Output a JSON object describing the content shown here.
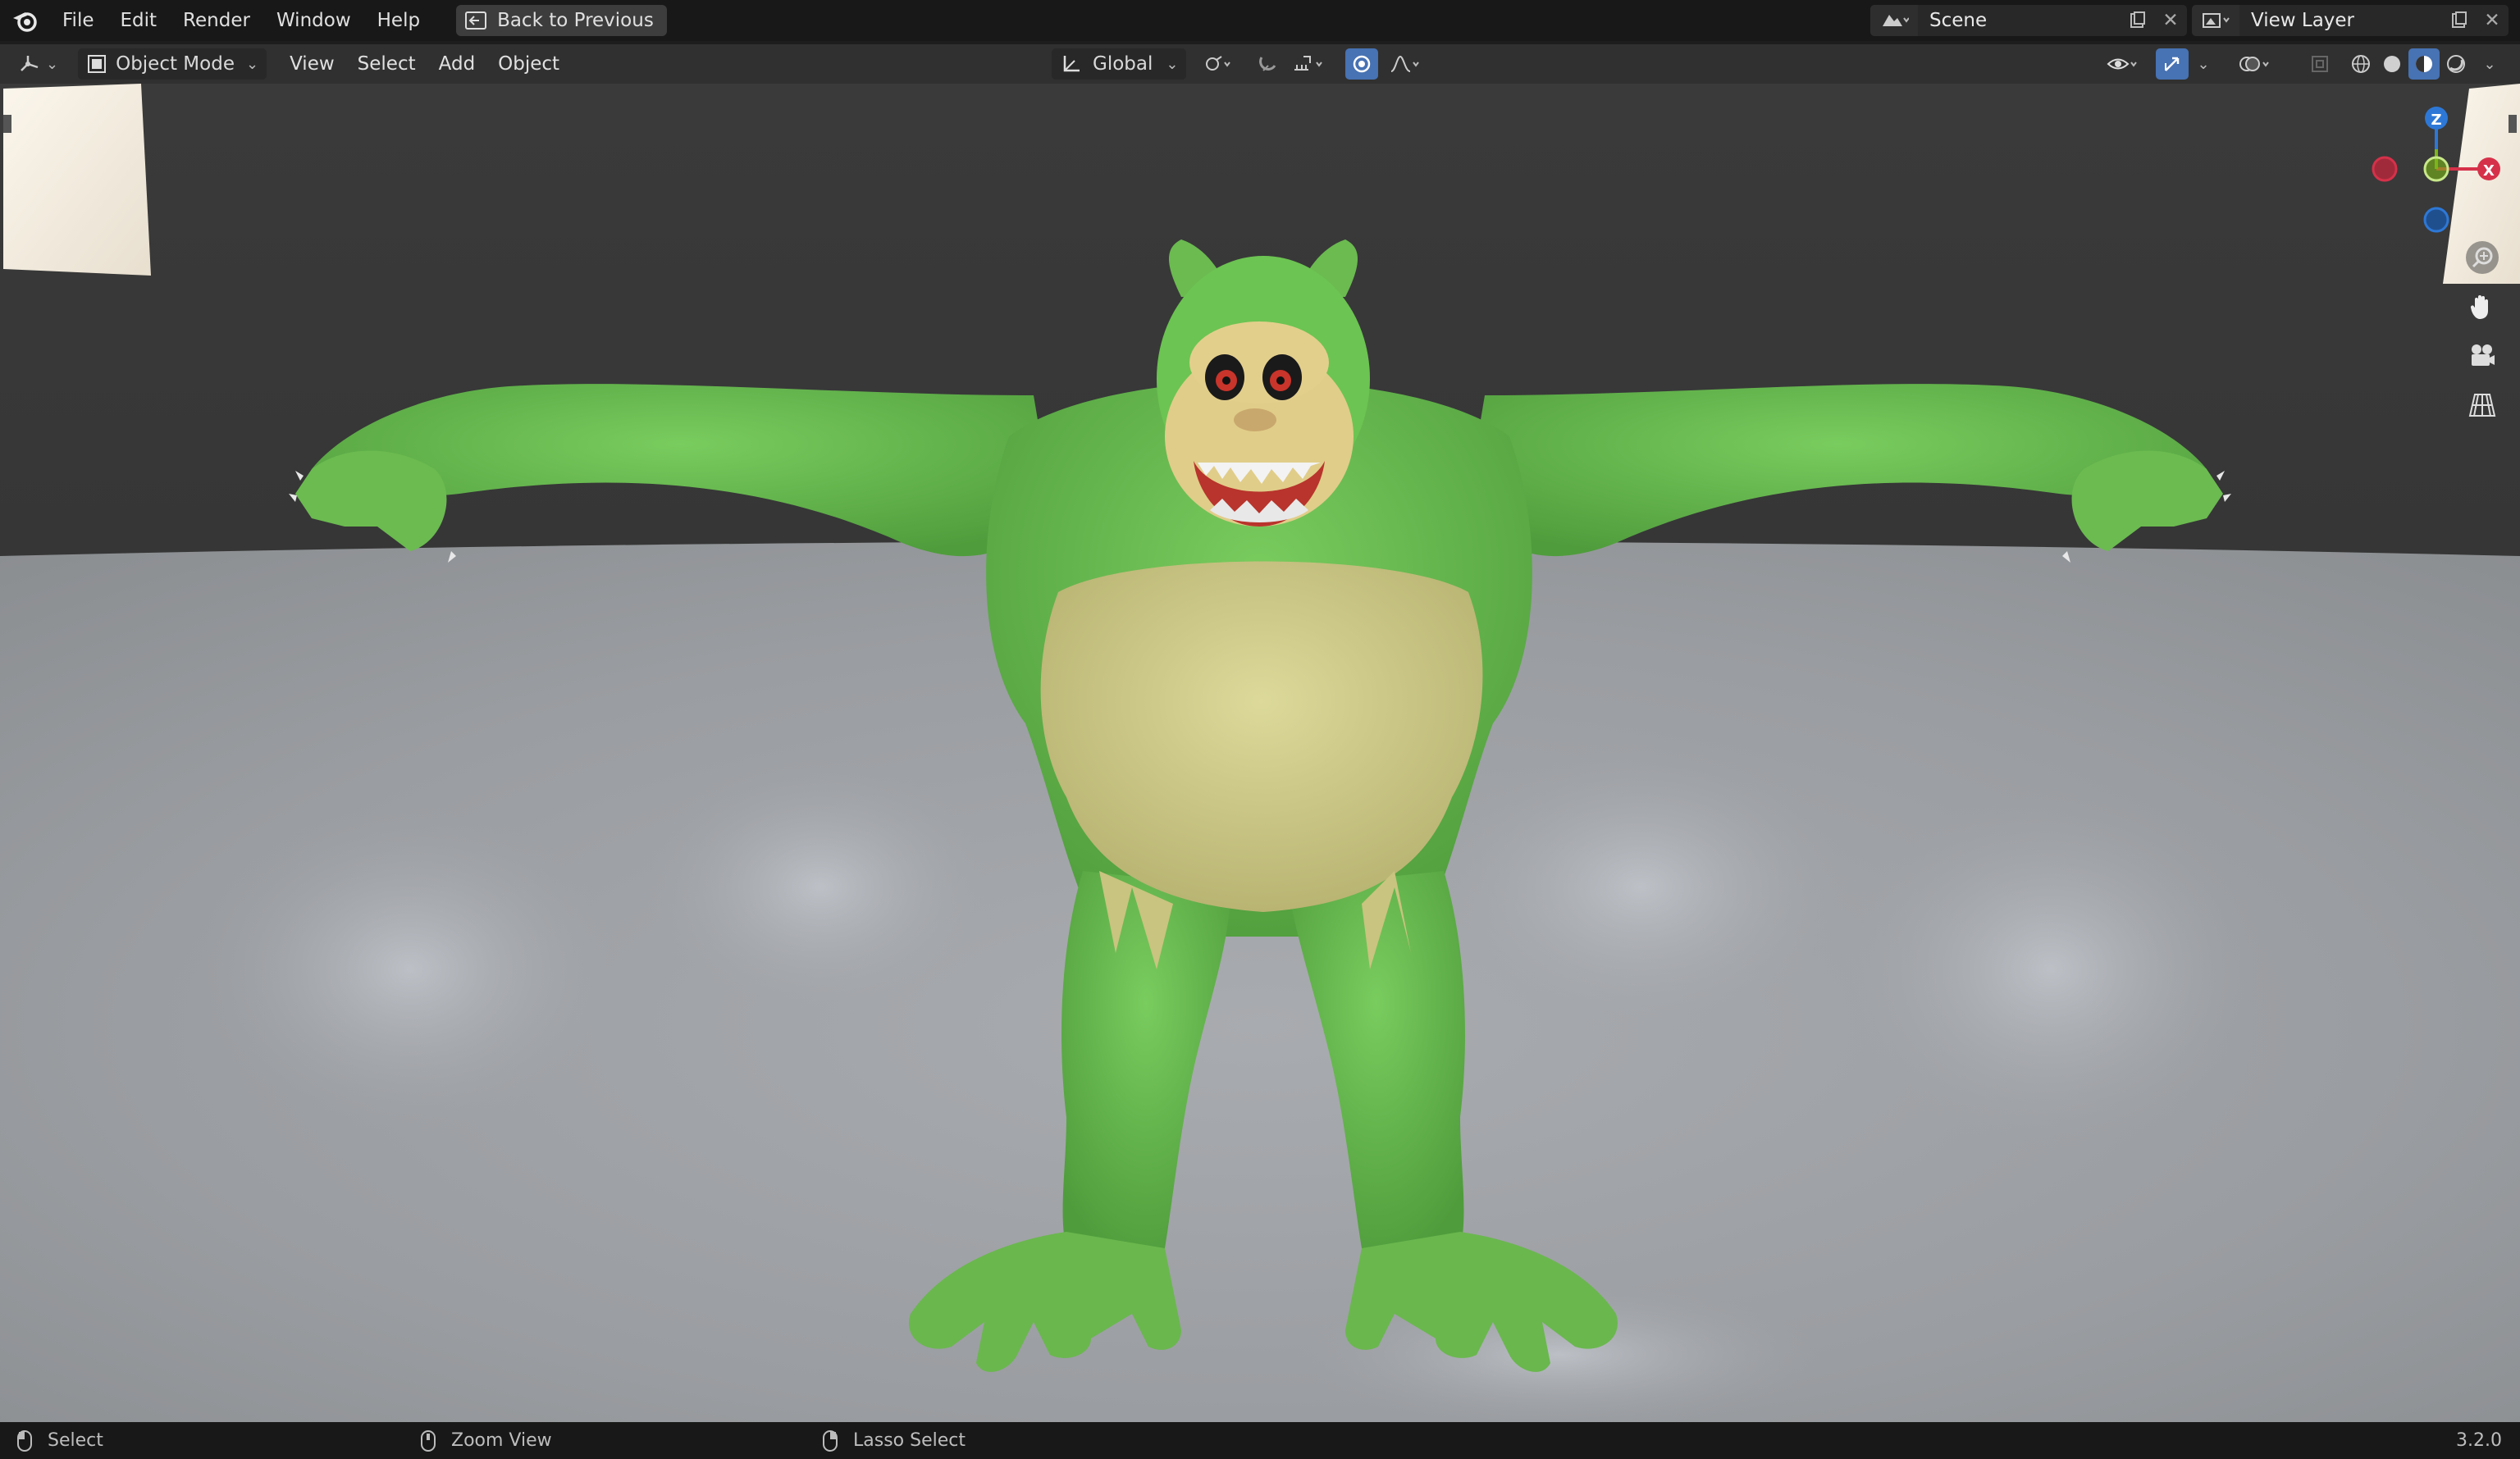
{
  "menu": [
    "File",
    "Edit",
    "Render",
    "Window",
    "Help"
  ],
  "back_to_previous": "Back to Previous",
  "scene": {
    "name": "Scene"
  },
  "view_layer": {
    "name": "View Layer"
  },
  "header": {
    "mode": "Object Mode",
    "menus": [
      "View",
      "Select",
      "Add",
      "Object"
    ],
    "transform_orientation": "Global"
  },
  "gizmo": {
    "z": "Z",
    "x": "X"
  },
  "status": {
    "select": "Select",
    "zoom": "Zoom View",
    "lasso": "Lasso Select",
    "version": "3.2.0"
  },
  "colors": {
    "accent": "#4772b3",
    "axis_x": "#d6314a",
    "axis_y": "#7cb518",
    "axis_z": "#2d78d6",
    "character_green": "#6cc452",
    "character_belly": "#d3d08a"
  }
}
